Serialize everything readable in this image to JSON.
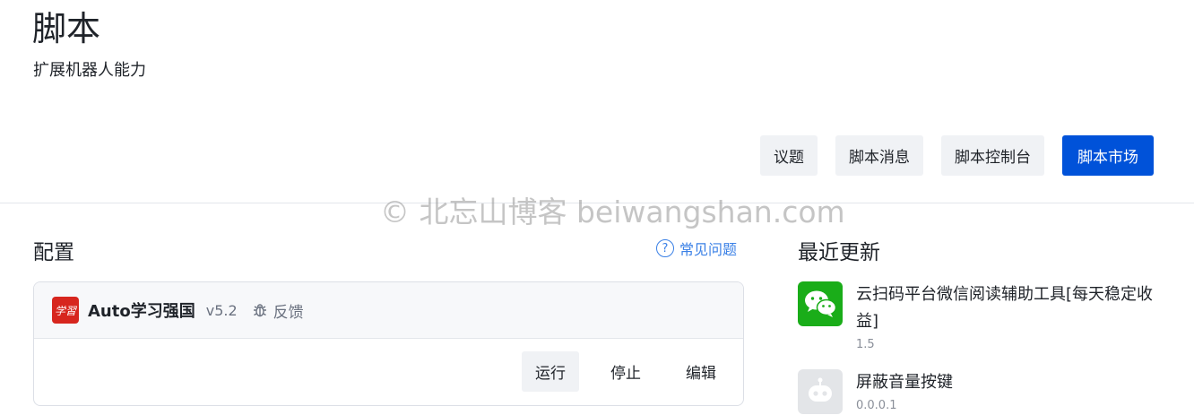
{
  "header": {
    "title": "脚本",
    "subtitle": "扩展机器人能力"
  },
  "toolbar": {
    "buttons": [
      {
        "label": "议题"
      },
      {
        "label": "脚本消息"
      },
      {
        "label": "脚本控制台"
      },
      {
        "label": "脚本市场"
      }
    ],
    "primary_color": "#0052d9"
  },
  "watermark": "© 北忘山博客 beiwangshan.com",
  "config": {
    "title": "配置",
    "faq_label": "常见问题",
    "faq_icon": "question-circle-icon",
    "script": {
      "name": "Auto学习强国",
      "version": "v5.2",
      "feedback_label": "反馈",
      "feedback_icon": "bug-icon",
      "logo_text": "学習",
      "logo_color": "#d7261e",
      "actions": [
        {
          "label": "运行"
        },
        {
          "label": "停止"
        },
        {
          "label": "编辑"
        }
      ]
    }
  },
  "recent_updates": {
    "title": "最近更新",
    "items": [
      {
        "name": "云扫码平台微信阅读辅助工具[每天稳定收益]",
        "version": "1.5",
        "icon": "wechat-icon",
        "icon_color": "#1aad19"
      },
      {
        "name": "屏蔽音量按键",
        "version": "0.0.0.1",
        "icon": "robot-icon",
        "icon_color": "#e3e5e8"
      }
    ]
  }
}
